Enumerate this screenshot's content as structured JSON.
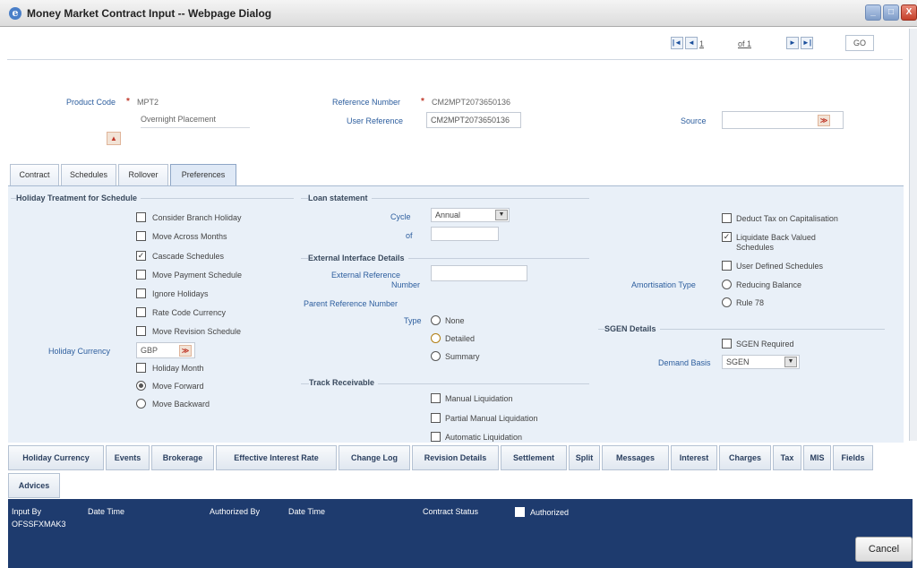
{
  "window": {
    "title": "Money Market Contract Input -- Webpage Dialog"
  },
  "pager": {
    "current": "1",
    "of_label": "of 1",
    "go_label": "GO"
  },
  "header": {
    "product_code_label": "Product Code",
    "product_code": "MPT2",
    "product_desc": "Overnight Placement",
    "reference_number_label": "Reference Number",
    "reference_number": "CM2MPT2073650136",
    "user_reference_label": "User Reference",
    "user_reference": "CM2MPT2073650136",
    "source_label": "Source",
    "source_value": ""
  },
  "tabs": [
    {
      "label": "Contract"
    },
    {
      "label": "Schedules"
    },
    {
      "label": "Rollover"
    },
    {
      "label": "Preferences"
    }
  ],
  "holiday": {
    "title": "Holiday Treatment for Schedule",
    "options": [
      {
        "label": "Consider Branch Holiday",
        "checked": false
      },
      {
        "label": "Move Across Months",
        "checked": false
      },
      {
        "label": "Cascade Schedules",
        "checked": true
      },
      {
        "label": "Move Payment Schedule",
        "checked": false
      },
      {
        "label": "Ignore Holidays",
        "checked": false
      },
      {
        "label": "Rate Code Currency",
        "checked": false
      },
      {
        "label": "Move Revision Schedule",
        "checked": false
      }
    ],
    "currency_label": "Holiday Currency",
    "currency_value": "GBP",
    "holiday_month_label": "Holiday Month",
    "move_forward_label": "Move Forward",
    "move_backward_label": "Move Backward"
  },
  "loan_statement": {
    "title": "Loan statement",
    "cycle_label": "Cycle",
    "cycle_value": "Annual",
    "of_label": "of"
  },
  "external": {
    "title": "External Interface Details",
    "ext_ref_label_1": "External Reference",
    "ext_ref_label_2": "Number",
    "parent_ref_label": "Parent Reference Number",
    "type_label": "Type",
    "type_none": "None",
    "type_detailed": "Detailed",
    "type_summary": "Summary"
  },
  "track": {
    "title": "Track Receivable",
    "manual": "Manual Liquidation",
    "partial": "Partial Manual Liquidation",
    "automatic": "Automatic Liquidation"
  },
  "right": {
    "deduct_tax": "Deduct Tax on Capitalisation",
    "liquidate_back_1": "Liquidate Back Valued",
    "liquidate_back_2": "Schedules",
    "user_defined": "User Defined Schedules",
    "amortisation_label": "Amortisation Type",
    "reducing_balance": "Reducing Balance",
    "rule78": "Rule 78"
  },
  "sgen": {
    "title": "SGEN Details",
    "required_label": "SGEN Required",
    "demand_basis_label": "Demand Basis",
    "demand_basis_value": "SGEN"
  },
  "bottom_buttons": [
    "Holiday Currency",
    "Events",
    "Brokerage",
    "Effective Interest Rate",
    "Change Log",
    "Revision Details",
    "Settlement",
    "Split",
    "Messages",
    "Interest",
    "Charges",
    "Tax",
    "MIS",
    "Fields"
  ],
  "advices_label": "Advices",
  "footer": {
    "input_by_label": "Input By",
    "input_by_value": "OFSSFXMAK3",
    "date_time_label": "Date Time",
    "authorized_by_label": "Authorized By",
    "date_time_label_2": "Date Time",
    "contract_status_label": "Contract Status",
    "authorized_label": "Authorized"
  },
  "cancel_label": "Cancel"
}
